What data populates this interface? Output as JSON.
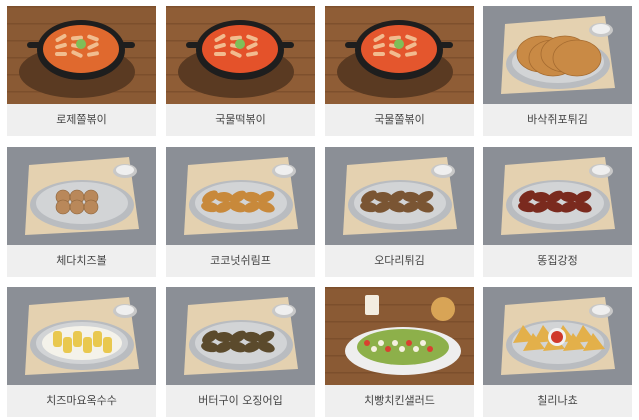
{
  "menu": {
    "items": [
      {
        "label": "로제쫄볶이",
        "bg": "#8a5a34",
        "dish": "pan",
        "sauce": "#e0692e"
      },
      {
        "label": "국물떡볶이",
        "bg": "#8f5d36",
        "dish": "pan",
        "sauce": "#e4522a"
      },
      {
        "label": "국물쫄볶이",
        "bg": "#8f5d36",
        "dish": "pan",
        "sauce": "#e4562d"
      },
      {
        "label": "바삭쥐포튀김",
        "bg": "#8b8f96",
        "dish": "chips",
        "sauce": "#c98a45"
      },
      {
        "label": "체다치즈볼",
        "bg": "#8b8f96",
        "dish": "balls",
        "sauce": "#b9885a"
      },
      {
        "label": "코코넛쉬림프",
        "bg": "#8b8f96",
        "dish": "fried",
        "sauce": "#c8893b"
      },
      {
        "label": "오다리튀김",
        "bg": "#8b8f96",
        "dish": "fried",
        "sauce": "#7a5533"
      },
      {
        "label": "똥집강정",
        "bg": "#8b8f96",
        "dish": "fried",
        "sauce": "#7a2a1e"
      },
      {
        "label": "치즈마요옥수수",
        "bg": "#8b8f96",
        "dish": "corn",
        "sauce": "#e9c84f"
      },
      {
        "label": "버터구이 오징어입",
        "bg": "#8b8f96",
        "dish": "fried",
        "sauce": "#5b4a2c"
      },
      {
        "label": "치빵치킨샐러드",
        "bg": "#8a5a34",
        "dish": "salad",
        "sauce": "#8db04a"
      },
      {
        "label": "칠리나쵸",
        "bg": "#8b8f96",
        "dish": "nachos",
        "sauce": "#e3b04a"
      }
    ]
  }
}
